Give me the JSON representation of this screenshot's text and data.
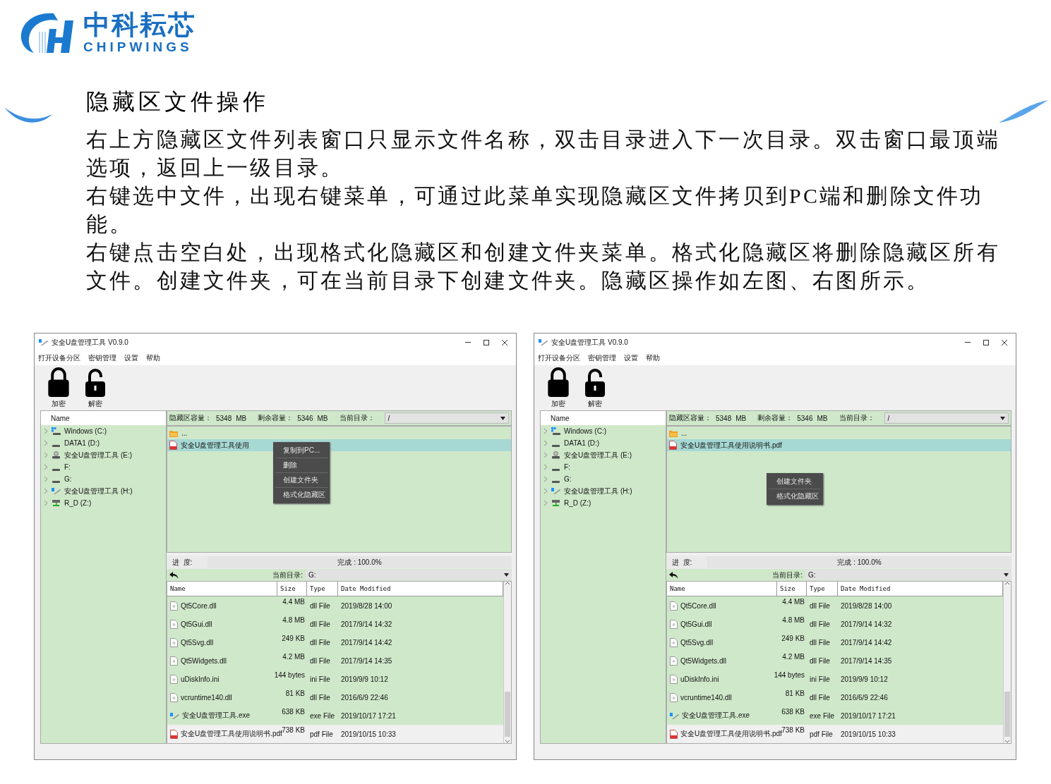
{
  "logo": {
    "chinese": "中科耘芯",
    "english": "CHIPWINGS"
  },
  "heading": "隐藏区文件操作",
  "paragraphs": [
    "右上方隐藏区文件列表窗口只显示文件名称，双击目录进入下一次目录。双击窗口最顶端选项，返回上一级目录。",
    "右键选中文件，出现右键菜单，可通过此菜单实现隐藏区文件拷贝到PC端和删除文件功能。",
    "右键点击空白处，出现格式化隐藏区和创建文件夹菜单。格式化隐藏区将删除隐藏区所有文件。创建文件夹，可在当前目录下创建文件夹。隐藏区操作如左图、右图所示。"
  ],
  "windows": [
    {
      "title": "安全U盘管理工具 V0.9.0",
      "menu": [
        "打开设备分区",
        "密钥管理",
        "设置",
        "帮助"
      ],
      "tools": [
        {
          "label": "加密",
          "kind": "locked"
        },
        {
          "label": "解密",
          "kind": "unlocked"
        }
      ],
      "tree_header": "Name",
      "drives": [
        {
          "label": "Windows (C:)",
          "kind": "windows"
        },
        {
          "label": "DATA1 (D:)",
          "kind": "disk"
        },
        {
          "label": "安全U盘管理工具 (E:)",
          "kind": "usb"
        },
        {
          "label": "F:",
          "kind": "disk"
        },
        {
          "label": "G:",
          "kind": "disk"
        },
        {
          "label": "安全U盘管理工具 (H:)",
          "kind": "app"
        },
        {
          "label": "R_D (Z:)",
          "kind": "network"
        }
      ],
      "info": {
        "capacity_label": "隐藏区容量：",
        "capacity": "5348",
        "capacity_unit": "MB",
        "free_label": "剩余容量：",
        "free": "5346",
        "free_unit": "MB",
        "dir_label": "当前目录：",
        "dir": "/"
      },
      "hidden_files": [
        {
          "name": "...",
          "kind": "folder",
          "selected": false
        },
        {
          "name": "安全U盘管理工具使用",
          "kind": "pdf",
          "selected": true
        }
      ],
      "context_menu": [
        "复制到PC...",
        "删除",
        "创建文件夹",
        "格式化隐藏区"
      ],
      "progress": {
        "label": "进  度:",
        "text": "完成 : 100.0%",
        "level": 1
      },
      "local": {
        "dir_label": "当前目录:",
        "dir": "G:"
      },
      "columns": [
        "Name",
        "Size",
        "Type",
        "Date Modified"
      ],
      "files": [
        {
          "name": "Qt5Core.dll",
          "size": "4.4 MB",
          "type": "dll File",
          "date": "2019/8/28 14:00",
          "kind": "dll",
          "selected": false
        },
        {
          "name": "Qt5Gui.dll",
          "size": "4.8 MB",
          "type": "dll File",
          "date": "2017/9/14 14:32",
          "kind": "dll",
          "selected": false
        },
        {
          "name": "Qt5Svg.dll",
          "size": "249 KB",
          "type": "dll File",
          "date": "2017/9/14 14:42",
          "kind": "dll",
          "selected": false
        },
        {
          "name": "Qt5Widgets.dll",
          "size": "4.2 MB",
          "type": "dll File",
          "date": "2017/9/14 14:35",
          "kind": "dll",
          "selected": false
        },
        {
          "name": "uDiskInfo.ini",
          "size": "144 bytes",
          "type": "ini File",
          "date": "2019/9/9 10:12",
          "kind": "ini",
          "selected": false
        },
        {
          "name": "vcruntime140.dll",
          "size": "81 KB",
          "type": "dll File",
          "date": "2016/6/9 22:46",
          "kind": "dll",
          "selected": false
        },
        {
          "name": "安全U盘管理工具.exe",
          "size": "638 KB",
          "type": "exe File",
          "date": "2019/10/17 17:21",
          "kind": "exe",
          "selected": false
        },
        {
          "name": "安全U盘管理工具使用说明书.pdf",
          "size": "738 KB",
          "type": "pdf File",
          "date": "2019/10/15 10:33",
          "kind": "pdf",
          "selected": true
        }
      ]
    },
    {
      "title": "安全U盘管理工具 V0.9.0",
      "menu": [
        "打开设备分区",
        "密钥管理",
        "设置",
        "帮助"
      ],
      "tools": [
        {
          "label": "加密",
          "kind": "locked"
        },
        {
          "label": "解密",
          "kind": "unlocked"
        }
      ],
      "tree_header": "Name",
      "drives": [
        {
          "label": "Windows (C:)",
          "kind": "windows"
        },
        {
          "label": "DATA1 (D:)",
          "kind": "disk"
        },
        {
          "label": "安全U盘管理工具 (E:)",
          "kind": "usb"
        },
        {
          "label": "F:",
          "kind": "disk"
        },
        {
          "label": "G:",
          "kind": "disk"
        },
        {
          "label": "安全U盘管理工具 (H:)",
          "kind": "app"
        },
        {
          "label": "R_D (Z:)",
          "kind": "network"
        }
      ],
      "info": {
        "capacity_label": "隐藏区容量：",
        "capacity": "5348",
        "capacity_unit": "MB",
        "free_label": "剩余容量：",
        "free": "5346",
        "free_unit": "MB",
        "dir_label": "当前目录：",
        "dir": "/"
      },
      "hidden_files": [
        {
          "name": "...",
          "kind": "folder",
          "selected": false
        },
        {
          "name": "安全U盘管理工具使用说明书.pdf",
          "kind": "pdf",
          "selected": true
        }
      ],
      "context_menu": [
        "创建文件夹",
        "格式化隐藏区"
      ],
      "progress": {
        "label": "进  度:",
        "text": "完成 : 100.0%",
        "level": 1
      },
      "local": {
        "dir_label": "当前目录:",
        "dir": "G:"
      },
      "columns": [
        "Name",
        "Size",
        "Type",
        "Date Modified"
      ],
      "files": [
        {
          "name": "Qt5Core.dll",
          "size": "4.4 MB",
          "type": "dll File",
          "date": "2019/8/28 14:00",
          "kind": "dll",
          "selected": false
        },
        {
          "name": "Qt5Gui.dll",
          "size": "4.8 MB",
          "type": "dll File",
          "date": "2017/9/14 14:32",
          "kind": "dll",
          "selected": false
        },
        {
          "name": "Qt5Svg.dll",
          "size": "249 KB",
          "type": "dll File",
          "date": "2017/9/14 14:42",
          "kind": "dll",
          "selected": false
        },
        {
          "name": "Qt5Widgets.dll",
          "size": "4.2 MB",
          "type": "dll File",
          "date": "2017/9/14 14:35",
          "kind": "dll",
          "selected": false
        },
        {
          "name": "uDiskInfo.ini",
          "size": "144 bytes",
          "type": "ini File",
          "date": "2019/9/9 10:12",
          "kind": "ini",
          "selected": false
        },
        {
          "name": "vcruntime140.dll",
          "size": "81 KB",
          "type": "dll File",
          "date": "2016/6/9 22:46",
          "kind": "dll",
          "selected": false
        },
        {
          "name": "安全U盘管理工具.exe",
          "size": "638 KB",
          "type": "exe File",
          "date": "2019/10/17 17:21",
          "kind": "exe",
          "selected": false
        },
        {
          "name": "安全U盘管理工具使用说明书.pdf",
          "size": "738 KB",
          "type": "pdf File",
          "date": "2019/10/15 10:33",
          "kind": "pdf",
          "selected": true
        }
      ]
    }
  ]
}
